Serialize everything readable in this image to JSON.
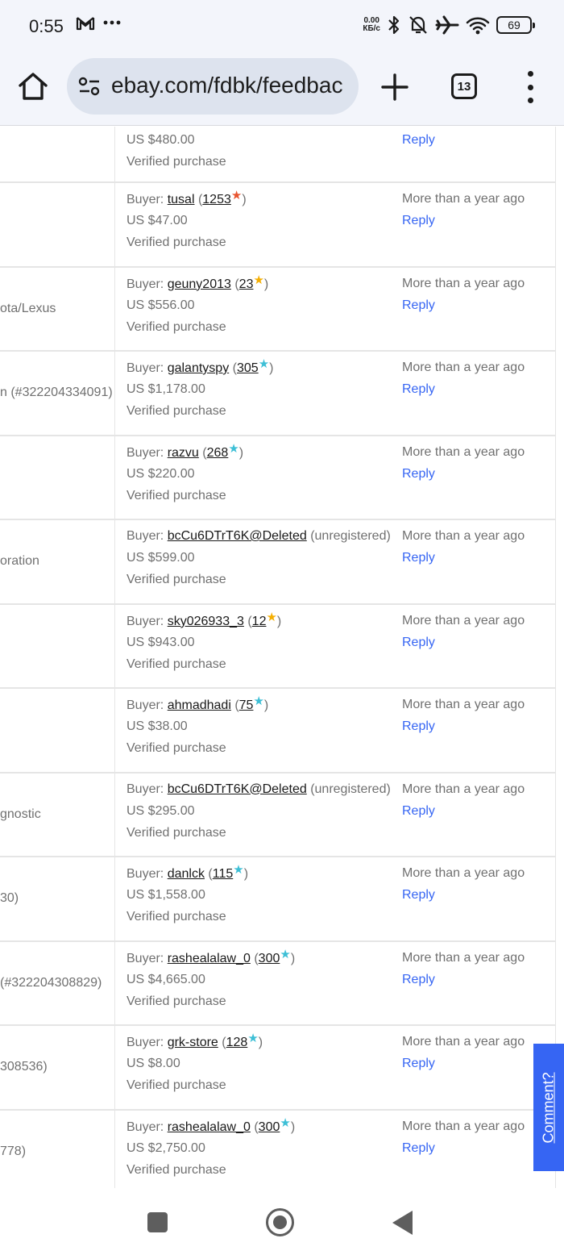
{
  "status_bar": {
    "time": "0:55",
    "net_speed_value": "0.00",
    "net_speed_unit": "КБ/с",
    "battery": "69",
    "icons": [
      "gmail-icon",
      "more-dots-icon",
      "bluetooth-icon",
      "bell-off-icon",
      "airplane-icon",
      "wifi-icon",
      "battery-icon"
    ]
  },
  "browser": {
    "url": "ebay.com/fdbk/feedbac",
    "tab_count": "13"
  },
  "feedback_rows": [
    {
      "item_fragment": "",
      "buyer_label": "",
      "buyer_name": "",
      "score": "",
      "score_suffix": "",
      "star_color": "",
      "price": "US $480.00",
      "verified": "Verified purchase",
      "when": "",
      "reply": "Reply"
    },
    {
      "item_fragment": "",
      "buyer_label": "Buyer:",
      "buyer_name": "tusal",
      "score": "1253",
      "score_suffix": "",
      "star_color": "#e8542f",
      "price": "US $47.00",
      "verified": "Verified purchase",
      "when": "More than a year ago",
      "reply": "Reply"
    },
    {
      "item_fragment": "ota/Lexus",
      "buyer_label": "Buyer:",
      "buyer_name": "geuny2013",
      "score": "23",
      "score_suffix": "",
      "star_color": "#f5af02",
      "price": "US $556.00",
      "verified": "Verified purchase",
      "when": "More than a year ago",
      "reply": "Reply"
    },
    {
      "item_fragment": "n (#322204334091)",
      "buyer_label": "Buyer:",
      "buyer_name": "galantyspy",
      "score": "305",
      "score_suffix": "",
      "star_color": "#3dbfd6",
      "price": "US $1,178.00",
      "verified": "Verified purchase",
      "when": "More than a year ago",
      "reply": "Reply"
    },
    {
      "item_fragment": "",
      "buyer_label": "Buyer:",
      "buyer_name": "razvu",
      "score": "268",
      "score_suffix": "",
      "star_color": "#3dbfd6",
      "price": "US $220.00",
      "verified": "Verified purchase",
      "when": "More than a year ago",
      "reply": "Reply"
    },
    {
      "item_fragment": "oration",
      "buyer_label": "Buyer:",
      "buyer_name": "bcCu6DTrT6K@Deleted",
      "score": "",
      "score_suffix": "(unregistered)",
      "star_color": "",
      "price": "US $599.00",
      "verified": "Verified purchase",
      "when": "More than a year ago",
      "reply": "Reply"
    },
    {
      "item_fragment": "",
      "buyer_label": "Buyer:",
      "buyer_name": "sky026933_3",
      "score": "12",
      "score_suffix": "",
      "star_color": "#f5af02",
      "price": "US $943.00",
      "verified": "Verified purchase",
      "when": "More than a year ago",
      "reply": "Reply"
    },
    {
      "item_fragment": "",
      "buyer_label": "Buyer:",
      "buyer_name": "ahmadhadi",
      "score": "75",
      "score_suffix": "",
      "star_color": "#3dbfd6",
      "price": "US $38.00",
      "verified": "Verified purchase",
      "when": "More than a year ago",
      "reply": "Reply"
    },
    {
      "item_fragment": "gnostic",
      "buyer_label": "Buyer:",
      "buyer_name": "bcCu6DTrT6K@Deleted",
      "score": "",
      "score_suffix": "(unregistered)",
      "star_color": "",
      "price": "US $295.00",
      "verified": "Verified purchase",
      "when": "More than a year ago",
      "reply": "Reply"
    },
    {
      "item_fragment": "30)",
      "buyer_label": "Buyer:",
      "buyer_name": "danlck",
      "score": "115",
      "score_suffix": "",
      "star_color": "#3dbfd6",
      "price": "US $1,558.00",
      "verified": "Verified purchase",
      "when": "More than a year ago",
      "reply": "Reply"
    },
    {
      "item_fragment": "(#322204308829)",
      "buyer_label": "Buyer:",
      "buyer_name": "rashealalaw_0",
      "score": "300",
      "score_suffix": "",
      "star_color": "#3dbfd6",
      "price": "US $4,665.00",
      "verified": "Verified purchase",
      "when": "More than a year ago",
      "reply": "Reply"
    },
    {
      "item_fragment": "308536)",
      "buyer_label": "Buyer:",
      "buyer_name": "grk-store",
      "score": "128",
      "score_suffix": "",
      "star_color": "#3dbfd6",
      "price": "US $8.00",
      "verified": "Verified purchase",
      "when": "More than a year ago",
      "reply": "Reply"
    },
    {
      "item_fragment": "778)",
      "buyer_label": "Buyer:",
      "buyer_name": "rashealalaw_0",
      "score": "300",
      "score_suffix": "",
      "star_color": "#3dbfd6",
      "price": "US $2,750.00",
      "verified": "Verified purchase",
      "when": "More than a year ago",
      "reply": "Reply"
    }
  ],
  "comment_tab": "Comment?",
  "colors": {
    "link_blue": "#3665f3",
    "star_orange": "#f5af02",
    "star_red": "#e8542f",
    "star_turquoise": "#3dbfd6"
  }
}
